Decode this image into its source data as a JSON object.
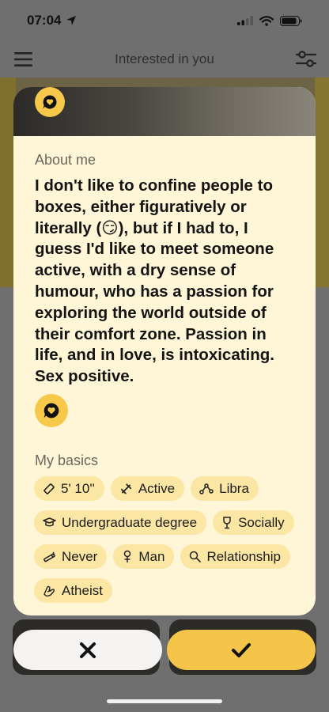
{
  "status_bar": {
    "time": "07:04"
  },
  "header": {
    "title": "Interested in you",
    "menu_icon": "hamburger-menu-icon",
    "filter_icon": "filter-sliders-icon"
  },
  "profile": {
    "about_label": "About me",
    "about_text": "I don't like to confine people to boxes, either figuratively or literally (😏), but if I had to, I guess I'd like to meet someone active, with a dry sense of humour, who has a passion for exploring the world outside of their comfort zone. Passion in life, and in love, is intoxicating. Sex positive.",
    "basics_label": "My basics",
    "basics": [
      {
        "icon": "ruler-icon",
        "label": "5' 10''"
      },
      {
        "icon": "dumbbell-icon",
        "label": "Active"
      },
      {
        "icon": "zodiac-icon",
        "label": "Libra"
      },
      {
        "icon": "graduation-cap-icon",
        "label": "Undergraduate degree"
      },
      {
        "icon": "wine-glass-icon",
        "label": "Socially"
      },
      {
        "icon": "cigarette-icon",
        "label": "Never"
      },
      {
        "icon": "gender-icon",
        "label": "Man"
      },
      {
        "icon": "magnifier-icon",
        "label": "Relationship"
      },
      {
        "icon": "praying-hands-icon",
        "label": "Atheist"
      }
    ]
  },
  "actions": {
    "pass_icon": "close-icon",
    "like_icon": "check-icon"
  },
  "colors": {
    "accent": "#f6c94a",
    "sheet_bg": "#fef6d6",
    "chip_bg": "#fbe6a4"
  }
}
